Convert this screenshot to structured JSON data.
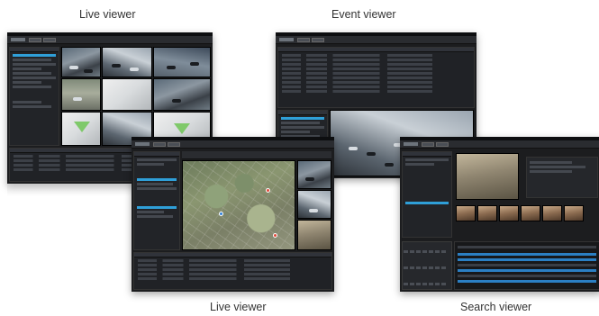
{
  "captions": {
    "live_viewer_top": "Live viewer",
    "event_viewer": "Event viewer",
    "live_viewer_bottom": "Live viewer",
    "search_viewer": "Search viewer"
  },
  "screenshots": [
    {
      "id": "live-viewer-1",
      "kind": "live viewer",
      "view": "camera-grid"
    },
    {
      "id": "event-viewer",
      "kind": "event viewer",
      "view": "event-list-with-video"
    },
    {
      "id": "live-viewer-2",
      "kind": "live viewer",
      "view": "map"
    },
    {
      "id": "search-viewer",
      "kind": "search viewer",
      "view": "playback-timeline"
    }
  ],
  "colors": {
    "background": "#ffffff",
    "window": "#1c1d1f",
    "selection": "#2f9fd8",
    "caption_text": "#333333"
  },
  "icons": [
    "camera-tile",
    "map-pin",
    "timeline-track",
    "calendar-grid"
  ]
}
